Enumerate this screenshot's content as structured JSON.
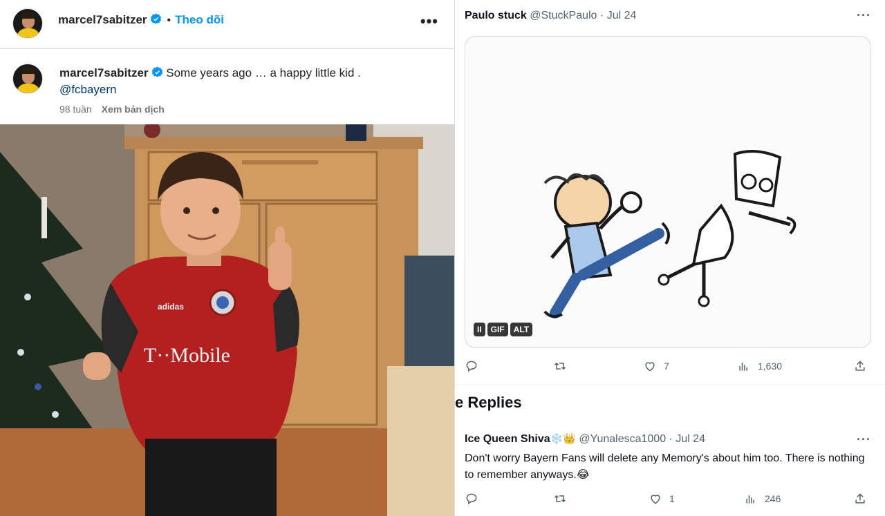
{
  "instagram": {
    "username": "marcel7sabitzer",
    "follow_label": "Theo dõi",
    "dot": "•",
    "more": "•••",
    "caption_text": "Some years ago … a happy little kid .",
    "mention": "@fcbayern",
    "time_ago": "98 tuần",
    "translate_label": "Xem bản dịch",
    "jersey_text": "T··Mobile",
    "brand_text": "adidas"
  },
  "twitter": {
    "post": {
      "name": "Paulo stuck",
      "handle": "@StuckPaulo",
      "separator": "·",
      "date": "Jul 24",
      "more": "···",
      "badges": {
        "pause": "II",
        "gif": "GIF",
        "alt": "ALT"
      },
      "likes": "7",
      "views": "1,630"
    },
    "replies_title": "e Replies",
    "reply": {
      "name": "Ice Queen Shiva",
      "emoji": "❄️👑",
      "handle": "@Yunalesca1000",
      "separator": "·",
      "date": "Jul 24",
      "more": "···",
      "text": "Don't worry Bayern Fans will delete any Memory's about him too. There is nothing to remember anyways.😂",
      "likes": "1",
      "views": "246"
    }
  },
  "colors": {
    "ig_follow": "#0095f6",
    "verified": "#0095f6",
    "tw_gray": "#536471",
    "jersey": "#b3201f"
  }
}
